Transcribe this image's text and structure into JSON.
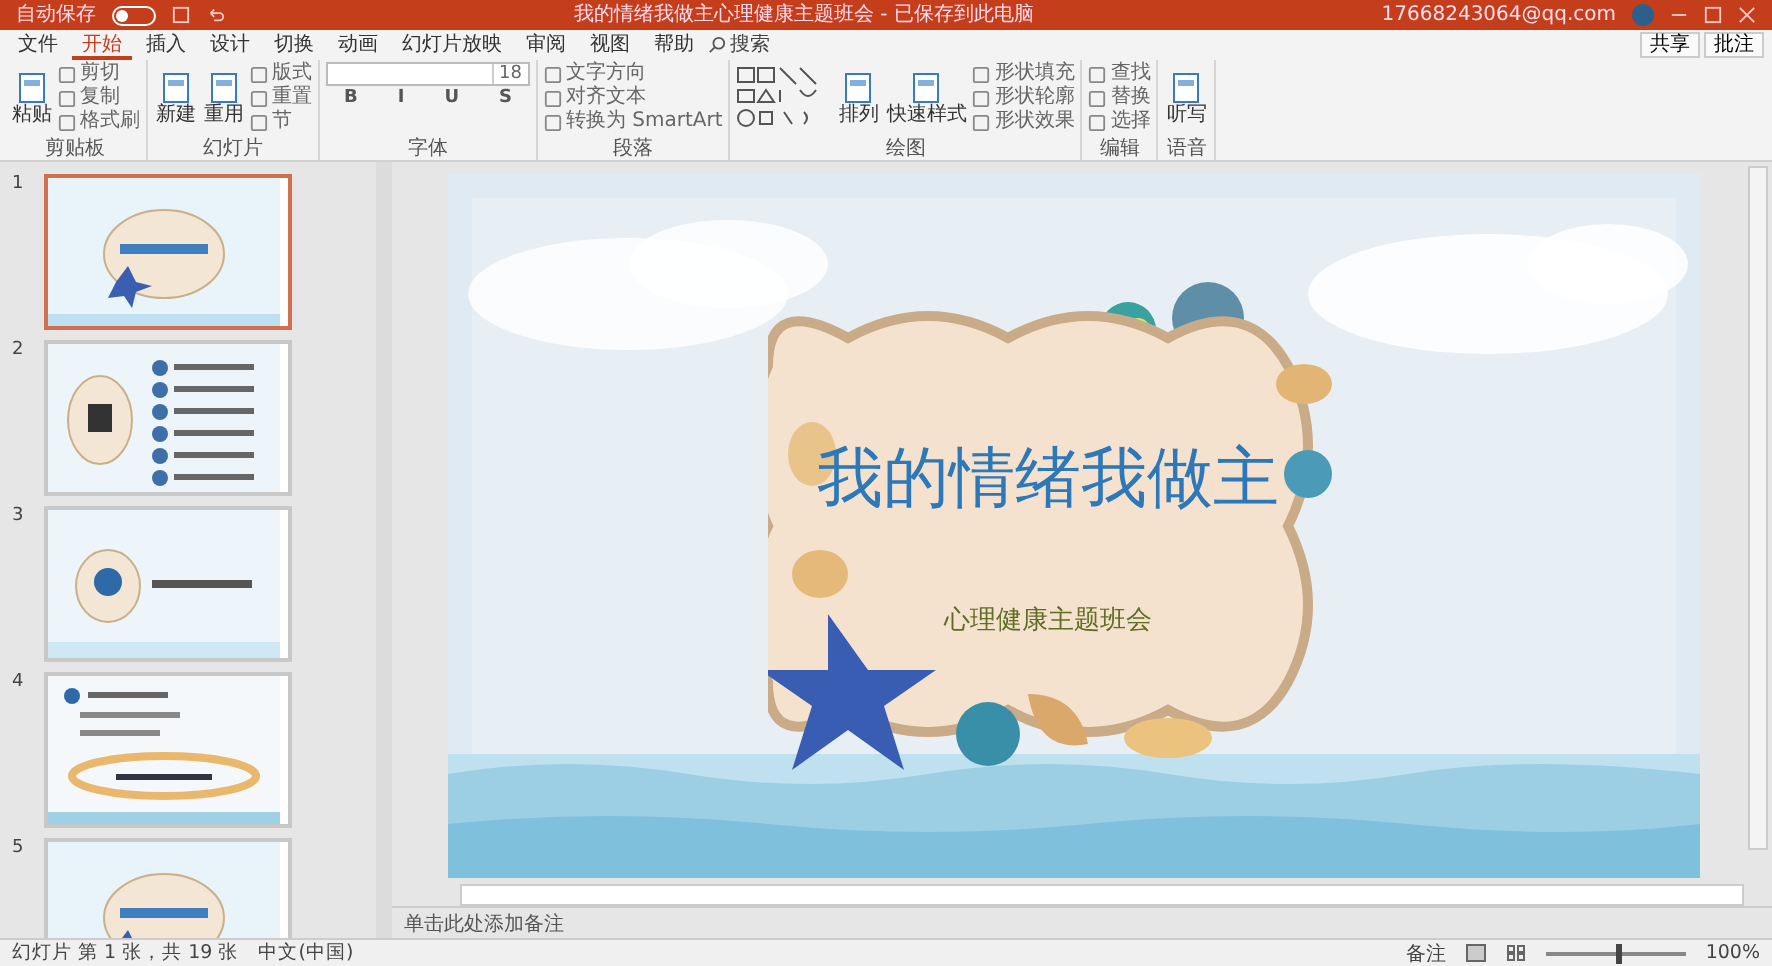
{
  "title_bar": {
    "autosave_label": "自动保存",
    "autosave_on": false,
    "document_title": "我的情绪我做主心理健康主题班会 - 已保存到此电脑",
    "account": "17668243064@qq.com"
  },
  "tabs": [
    {
      "label": "文件",
      "selected": false
    },
    {
      "label": "开始",
      "selected": true
    },
    {
      "label": "插入",
      "selected": false
    },
    {
      "label": "设计",
      "selected": false
    },
    {
      "label": "切换",
      "selected": false
    },
    {
      "label": "动画",
      "selected": false
    },
    {
      "label": "幻灯片放映",
      "selected": false
    },
    {
      "label": "审阅",
      "selected": false
    },
    {
      "label": "视图",
      "selected": false
    },
    {
      "label": "帮助",
      "selected": false
    }
  ],
  "search": {
    "placeholder": "搜索"
  },
  "actions": [
    "共享",
    "批注"
  ],
  "ribbon_groups": [
    {
      "label": "剪贴板",
      "buttons": [
        {
          "kind": "large",
          "label": "粘贴"
        },
        {
          "kind": "small",
          "label": "剪切"
        },
        {
          "kind": "small",
          "label": "复制"
        },
        {
          "kind": "small",
          "label": "格式刷"
        }
      ]
    },
    {
      "label": "幻灯片",
      "buttons": [
        {
          "kind": "large",
          "label": "新建"
        },
        {
          "kind": "large",
          "label": "重用"
        },
        {
          "kind": "small",
          "label": "版式"
        },
        {
          "kind": "small",
          "label": "重置"
        },
        {
          "kind": "small",
          "label": "节"
        }
      ]
    },
    {
      "label": "字体",
      "buttons": [
        {
          "kind": "field",
          "label": "18"
        },
        {
          "kind": "glyph",
          "label": "B"
        },
        {
          "kind": "glyph",
          "label": "I"
        },
        {
          "kind": "glyph",
          "label": "U"
        },
        {
          "kind": "glyph",
          "label": "S"
        }
      ]
    },
    {
      "label": "段落",
      "buttons": [
        {
          "kind": "small",
          "label": "文字方向"
        },
        {
          "kind": "small",
          "label": "对齐文本"
        },
        {
          "kind": "small",
          "label": "转换为 SmartArt"
        }
      ]
    },
    {
      "label": "绘图",
      "buttons": [
        {
          "kind": "shapes"
        },
        {
          "kind": "large",
          "label": "排列"
        },
        {
          "kind": "large",
          "label": "快速样式"
        },
        {
          "kind": "small",
          "label": "形状填充"
        },
        {
          "kind": "small",
          "label": "形状轮廓"
        },
        {
          "kind": "small",
          "label": "形状效果"
        }
      ]
    },
    {
      "label": "编辑",
      "buttons": [
        {
          "kind": "small",
          "label": "查找"
        },
        {
          "kind": "small",
          "label": "替换"
        },
        {
          "kind": "small",
          "label": "选择"
        }
      ]
    },
    {
      "label": "语音",
      "buttons": [
        {
          "kind": "large",
          "label": "听写"
        }
      ]
    }
  ],
  "slides": [
    {
      "number": "1",
      "selected": true,
      "kind": "title"
    },
    {
      "number": "2",
      "selected": false,
      "kind": "contents"
    },
    {
      "number": "3",
      "selected": false,
      "kind": "section"
    },
    {
      "number": "4",
      "selected": false,
      "kind": "text"
    },
    {
      "number": "5",
      "selected": false,
      "kind": "title"
    }
  ],
  "current_slide": {
    "title": "我的情绪我做主",
    "subtitle": "心理健康主题班会"
  },
  "notes": {
    "placeholder": "单击此处添加备注"
  },
  "status_bar": {
    "slide_count": "幻灯片 第 1 张，共 19 张",
    "language": "中文(中国)",
    "notes_button": "备注",
    "zoom": "100%",
    "level": 0.5
  }
}
